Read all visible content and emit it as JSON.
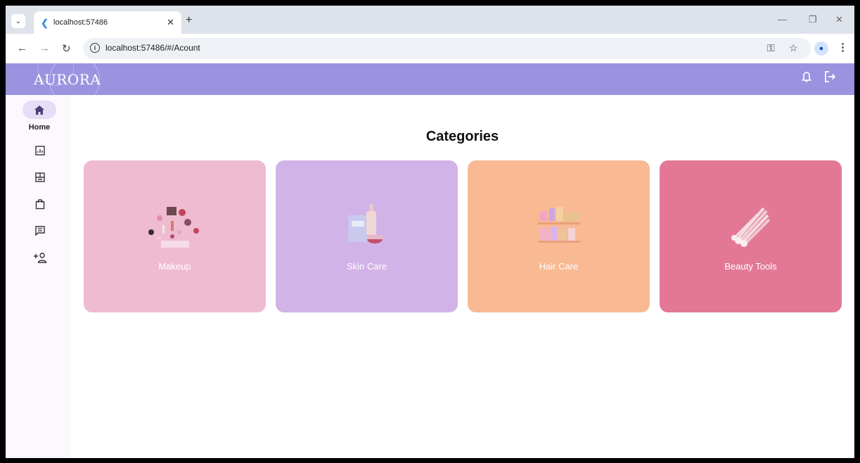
{
  "browser": {
    "tab_title": "localhost:57486",
    "url": "localhost:57486/#/Acount"
  },
  "app": {
    "logo": "AURORA"
  },
  "sidebar": {
    "home_label": "Home"
  },
  "main": {
    "title": "Categories",
    "categories": [
      {
        "label": "Makeup",
        "color": "#efbbd1"
      },
      {
        "label": "Skin Care",
        "color": "#d2b3e7"
      },
      {
        "label": "Hair Care",
        "color": "#f8b993"
      },
      {
        "label": "Beauty Tools",
        "color": "#e37896"
      }
    ]
  },
  "colors": {
    "appbar": "#9c93e0",
    "sidebar": "#fdf8fd"
  }
}
